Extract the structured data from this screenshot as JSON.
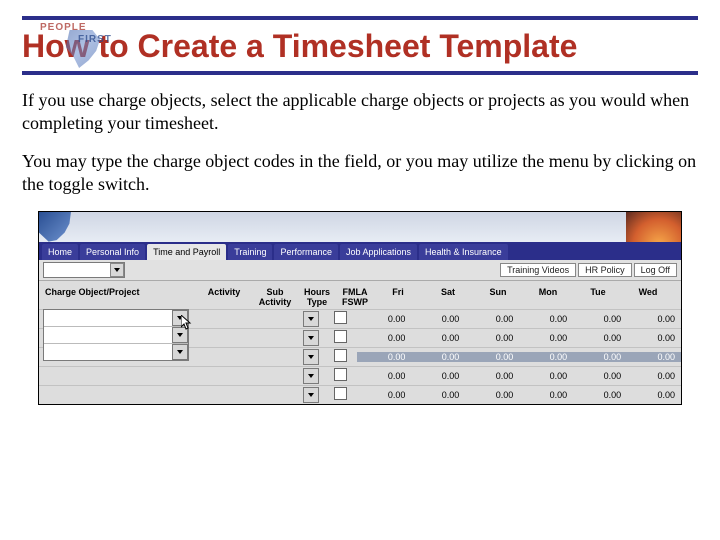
{
  "logo": {
    "line1": "PEOPLE",
    "line2": "FIRST"
  },
  "title": "How to Create a Timesheet Template",
  "paragraphs": [
    "If you use charge objects, select the applicable charge objects or projects as you would when completing your timesheet.",
    "You may type the charge object codes in the field, or you may utilize the menu by clicking on the toggle switch."
  ],
  "app": {
    "tabs": [
      "Home",
      "Personal Info",
      "Time and Payroll",
      "Training",
      "Performance",
      "Job Applications",
      "Health & Insurance"
    ],
    "active_tab_index": 2,
    "toolbar_links": [
      "Training Videos",
      "HR Policy",
      "Log Off"
    ],
    "grid": {
      "headers": {
        "charge_object": "Charge Object/Project",
        "activity": "Activity",
        "sub_activity": "Sub\nActivity",
        "hours_type": "Hours\nType",
        "fmla": "FMLA\nFSWP"
      },
      "days": [
        "Fri",
        "Sat",
        "Sun",
        "Mon",
        "Tue",
        "Wed"
      ],
      "rows": [
        {
          "fmla": false,
          "cells": [
            "0.00",
            "0.00",
            "0.00",
            "0.00",
            "0.00",
            "0.00"
          ]
        },
        {
          "fmla": false,
          "cells": [
            "0.00",
            "0.00",
            "0.00",
            "0.00",
            "0.00",
            "0.00"
          ]
        },
        {
          "fmla": false,
          "cells": [
            "0.00",
            "0.00",
            "0.00",
            "0.00",
            "0.00",
            "0.00"
          ]
        },
        {
          "fmla": false,
          "cells": [
            "0.00",
            "0.00",
            "0.00",
            "0.00",
            "0.00",
            "0.00"
          ]
        },
        {
          "fmla": false,
          "cells": [
            "0.00",
            "0.00",
            "0.00",
            "0.00",
            "0.00",
            "0.00"
          ]
        }
      ]
    }
  }
}
